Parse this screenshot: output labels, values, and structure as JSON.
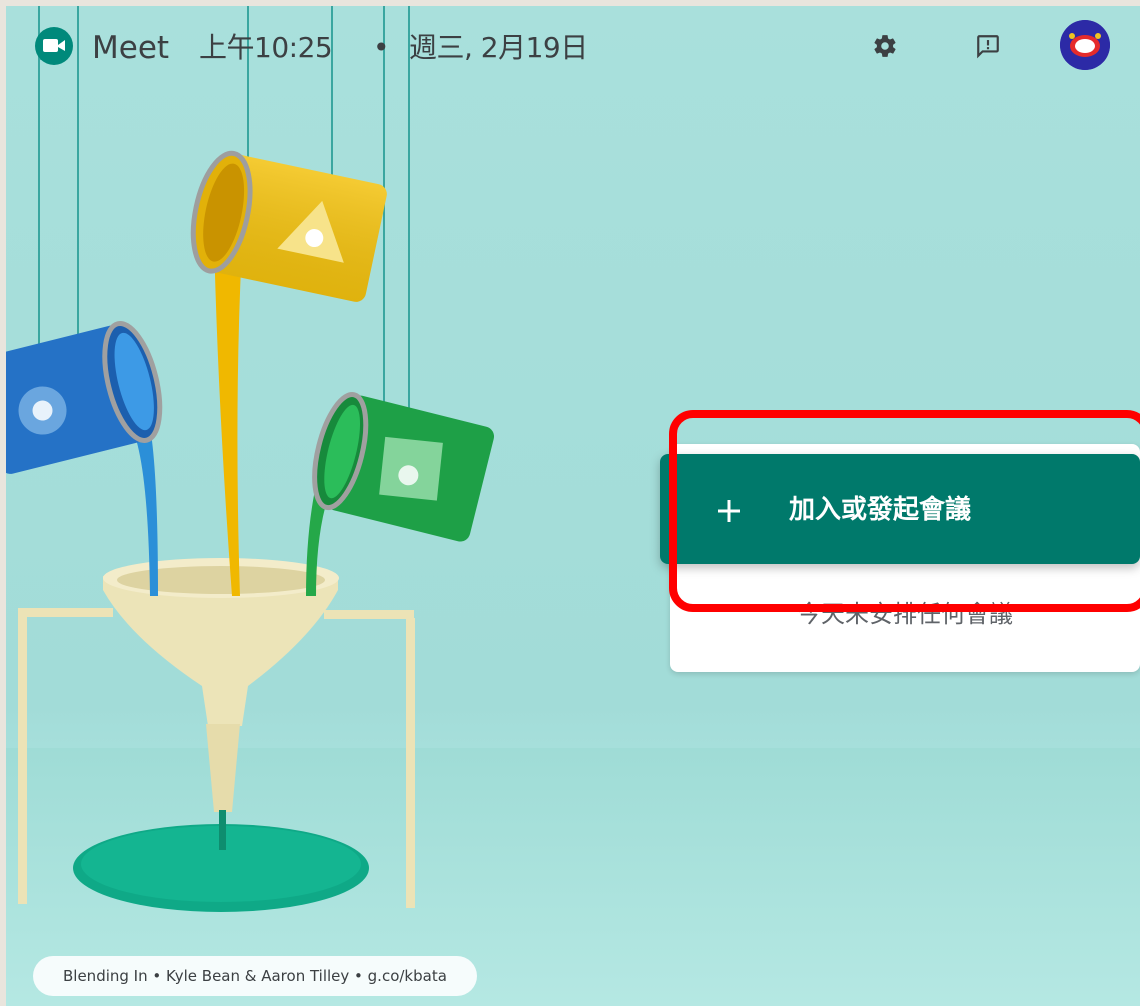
{
  "header": {
    "app_name": "Meet",
    "time": "上午10:25",
    "separator": "•",
    "date": "週三, 2月19日"
  },
  "icons": {
    "logo": "meet-logo-icon",
    "settings": "gear-icon",
    "feedback": "feedback-icon",
    "avatar": "user-avatar"
  },
  "main": {
    "join_button_label": "加入或發起會議",
    "empty_meetings_text": "今天未安排任何會議"
  },
  "attribution": {
    "text": "Blending In • Kyle Bean & Aaron Tilley • g.co/kbata"
  },
  "colors": {
    "accent": "#00796b",
    "highlight": "#ff0000",
    "background": "#a9e0dc"
  }
}
